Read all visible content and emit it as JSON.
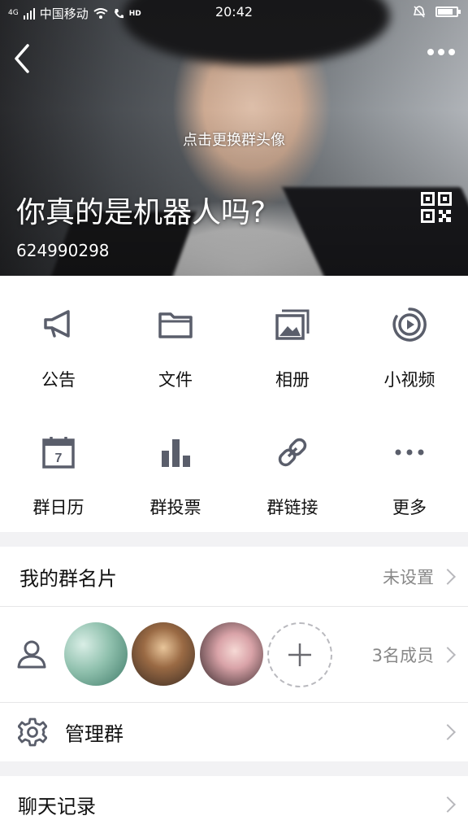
{
  "status_bar": {
    "network": "4G",
    "carrier": "中国移动",
    "hd": "HD",
    "time": "20:42"
  },
  "header": {
    "change_avatar_hint": "点击更换群头像",
    "group_name": "你真的是机器人吗?",
    "group_id": "624990298"
  },
  "features": [
    {
      "label": "公告",
      "icon": "megaphone-icon"
    },
    {
      "label": "文件",
      "icon": "folder-icon"
    },
    {
      "label": "相册",
      "icon": "photo-album-icon"
    },
    {
      "label": "小视频",
      "icon": "video-icon"
    },
    {
      "label": "群日历",
      "icon": "calendar-icon"
    },
    {
      "label": "群投票",
      "icon": "bar-chart-icon"
    },
    {
      "label": "群链接",
      "icon": "link-icon"
    },
    {
      "label": "更多",
      "icon": "more-icon"
    }
  ],
  "calendar_day": "7",
  "my_card": {
    "title": "我的群名片",
    "value": "未设置"
  },
  "members": {
    "count_label": "3名成员"
  },
  "manage": {
    "title": "管理群"
  },
  "chat_history": {
    "title": "聊天记录"
  },
  "colors": {
    "icon": "#5a5e6b",
    "text": "#111111",
    "secondary": "#888888"
  }
}
